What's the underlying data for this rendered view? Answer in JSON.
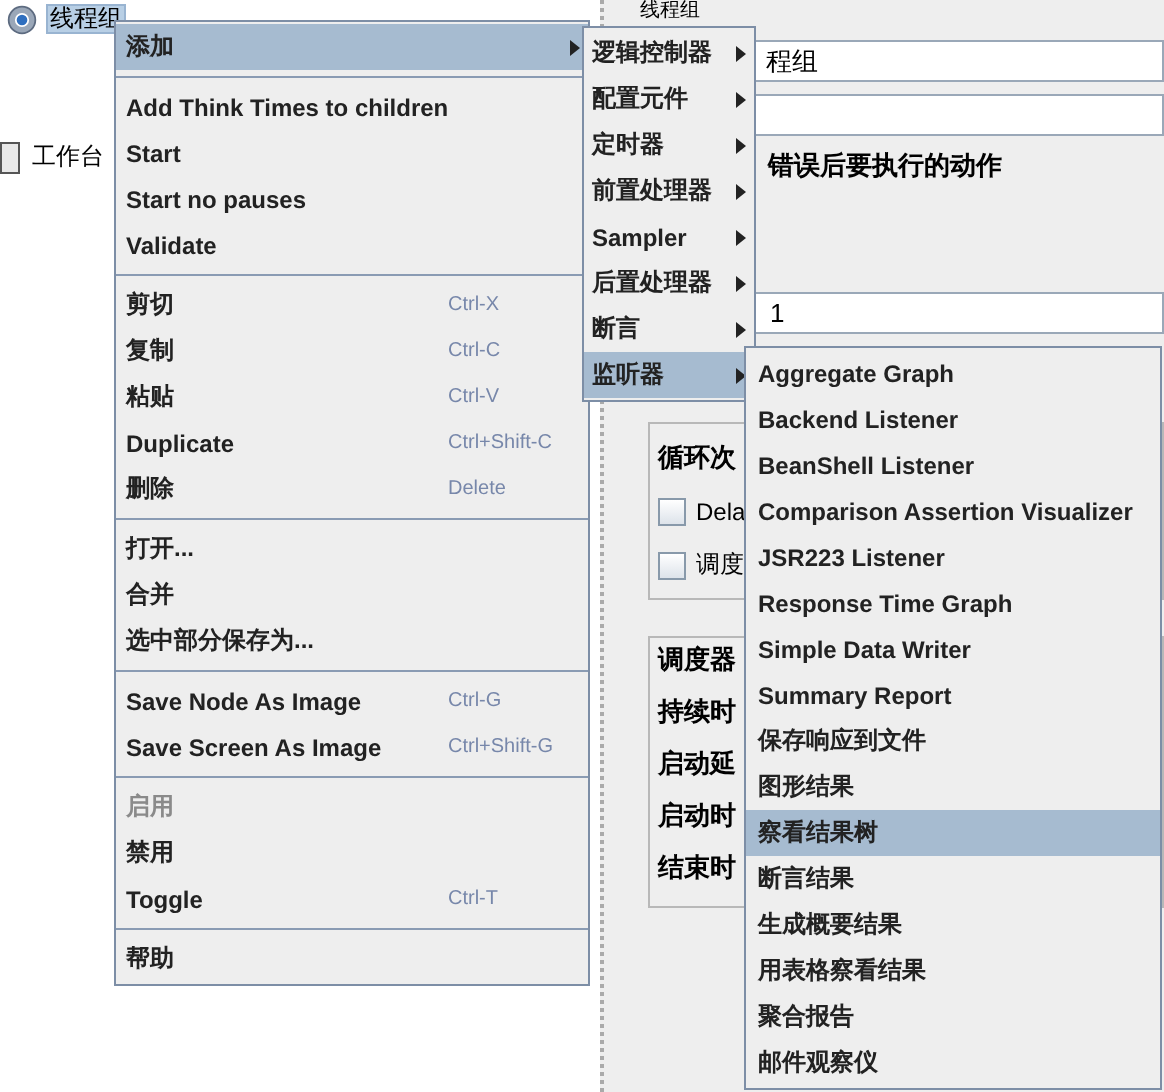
{
  "tree": [
    {
      "label": "线程组",
      "selected": true,
      "kind": "group"
    },
    {
      "label": "工作台",
      "selected": false,
      "kind": "bench"
    }
  ],
  "panel": {
    "title": "线程组",
    "name_value": "程组",
    "error_section": "错误后要执行的动作",
    "loop_value": "1",
    "loop_label": "循环次",
    "checkboxes": [
      {
        "label": "Dela",
        "checked": false
      },
      {
        "label": "调度",
        "checked": false
      }
    ],
    "scheduler_title": "调度器",
    "scheduler_rows": [
      "持续时",
      "启动延",
      "启动时",
      "结束时"
    ]
  },
  "context_menu": {
    "groups": [
      [
        {
          "label": "添加",
          "has_submenu": true,
          "selected": true,
          "disabled": false
        }
      ],
      [
        {
          "label": "Add Think Times to children",
          "has_submenu": false,
          "selected": false,
          "disabled": false
        },
        {
          "label": "Start",
          "has_submenu": false,
          "selected": false,
          "disabled": false
        },
        {
          "label": "Start no pauses",
          "has_submenu": false,
          "selected": false,
          "disabled": false
        },
        {
          "label": "Validate",
          "has_submenu": false,
          "selected": false,
          "disabled": false
        }
      ],
      [
        {
          "label": "剪切",
          "shortcut": "Ctrl-X",
          "has_submenu": false,
          "selected": false,
          "disabled": false
        },
        {
          "label": "复制",
          "shortcut": "Ctrl-C",
          "has_submenu": false,
          "selected": false,
          "disabled": false
        },
        {
          "label": "粘贴",
          "shortcut": "Ctrl-V",
          "has_submenu": false,
          "selected": false,
          "disabled": false
        },
        {
          "label": "Duplicate",
          "shortcut": "Ctrl+Shift-C",
          "has_submenu": false,
          "selected": false,
          "disabled": false
        },
        {
          "label": "删除",
          "shortcut": "Delete",
          "has_submenu": false,
          "selected": false,
          "disabled": false
        }
      ],
      [
        {
          "label": "打开...",
          "has_submenu": false,
          "selected": false,
          "disabled": false
        },
        {
          "label": "合并",
          "has_submenu": false,
          "selected": false,
          "disabled": false
        },
        {
          "label": "选中部分保存为...",
          "has_submenu": false,
          "selected": false,
          "disabled": false
        }
      ],
      [
        {
          "label": "Save Node As Image",
          "shortcut": "Ctrl-G",
          "has_submenu": false,
          "selected": false,
          "disabled": false
        },
        {
          "label": "Save Screen As Image",
          "shortcut": "Ctrl+Shift-G",
          "has_submenu": false,
          "selected": false,
          "disabled": false
        }
      ],
      [
        {
          "label": "启用",
          "has_submenu": false,
          "selected": false,
          "disabled": true
        },
        {
          "label": "禁用",
          "has_submenu": false,
          "selected": false,
          "disabled": false
        },
        {
          "label": "Toggle",
          "shortcut": "Ctrl-T",
          "has_submenu": false,
          "selected": false,
          "disabled": false
        }
      ],
      [
        {
          "label": "帮助",
          "has_submenu": false,
          "selected": false,
          "disabled": false
        }
      ]
    ]
  },
  "add_submenu": [
    {
      "label": "逻辑控制器",
      "selected": false
    },
    {
      "label": "配置元件",
      "selected": false
    },
    {
      "label": "定时器",
      "selected": false
    },
    {
      "label": "前置处理器",
      "selected": false
    },
    {
      "label": "Sampler",
      "selected": false
    },
    {
      "label": "后置处理器",
      "selected": false
    },
    {
      "label": "断言",
      "selected": false
    },
    {
      "label": "监听器",
      "selected": true
    }
  ],
  "listener_submenu": [
    {
      "label": "Aggregate Graph",
      "selected": false
    },
    {
      "label": "Backend Listener",
      "selected": false
    },
    {
      "label": "BeanShell Listener",
      "selected": false
    },
    {
      "label": "Comparison Assertion Visualizer",
      "selected": false
    },
    {
      "label": "JSR223 Listener",
      "selected": false
    },
    {
      "label": "Response Time Graph",
      "selected": false
    },
    {
      "label": "Simple Data Writer",
      "selected": false
    },
    {
      "label": "Summary Report",
      "selected": false
    },
    {
      "label": "保存响应到文件",
      "selected": false
    },
    {
      "label": "图形结果",
      "selected": false
    },
    {
      "label": "察看结果树",
      "selected": true
    },
    {
      "label": "断言结果",
      "selected": false
    },
    {
      "label": "生成概要结果",
      "selected": false
    },
    {
      "label": "用表格察看结果",
      "selected": false
    },
    {
      "label": "聚合报告",
      "selected": false
    },
    {
      "label": "邮件观察仪",
      "selected": false
    }
  ]
}
